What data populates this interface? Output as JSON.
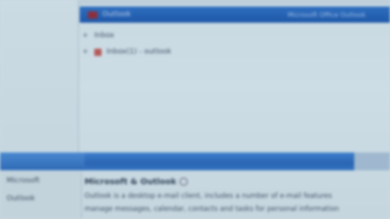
{
  "toolbar": {
    "title": "Outlook",
    "right_text": "Microsoft Office Outlook"
  },
  "tree": {
    "row1": {
      "expander": "+",
      "label": "Inbox"
    },
    "row2": {
      "expander": "+",
      "label": "Inbox(1) - outlook"
    }
  },
  "bottom_left": {
    "item1": "Microsoft",
    "item2": "Outlook"
  },
  "description": {
    "title": "Microsoft & Outlook",
    "line1": "Outlook is a desktop e-mail client, includes a number of e-mail features",
    "line2": "manage messages, calendar, contacts and tasks for personal information"
  }
}
